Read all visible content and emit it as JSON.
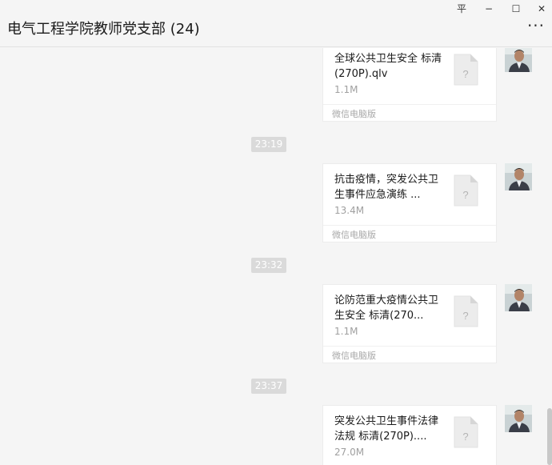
{
  "window": {
    "title": "电气工程学院教师党支部 (24)",
    "controls": {
      "pin": "平",
      "minimize": "−",
      "maximize": "☐",
      "close": "✕"
    },
    "more": "···"
  },
  "timestamps": [
    "23:19",
    "23:32",
    "23:37"
  ],
  "messages": [
    {
      "name": "全球公共卫生安全 标清(270P).qlv",
      "size": "1.1M",
      "source": "微信电脑版"
    },
    {
      "name": "抗击疫情，突发公共卫生事件应急演练 ...",
      "size": "13.4M",
      "source": "微信电脑版"
    },
    {
      "name": "论防范重大疫情公共卫生安全 标清(270...",
      "size": "1.1M",
      "source": "微信电脑版"
    },
    {
      "name": "突发公共卫生事件法律法规 标清(270P)....",
      "size": "27.0M",
      "source": ""
    }
  ],
  "file_icon_glyph": "?",
  "colors": {
    "background": "#f5f5f5",
    "card": "#ffffff",
    "timestamp_pill": "#dadada",
    "muted_text": "#a0a0a0"
  }
}
